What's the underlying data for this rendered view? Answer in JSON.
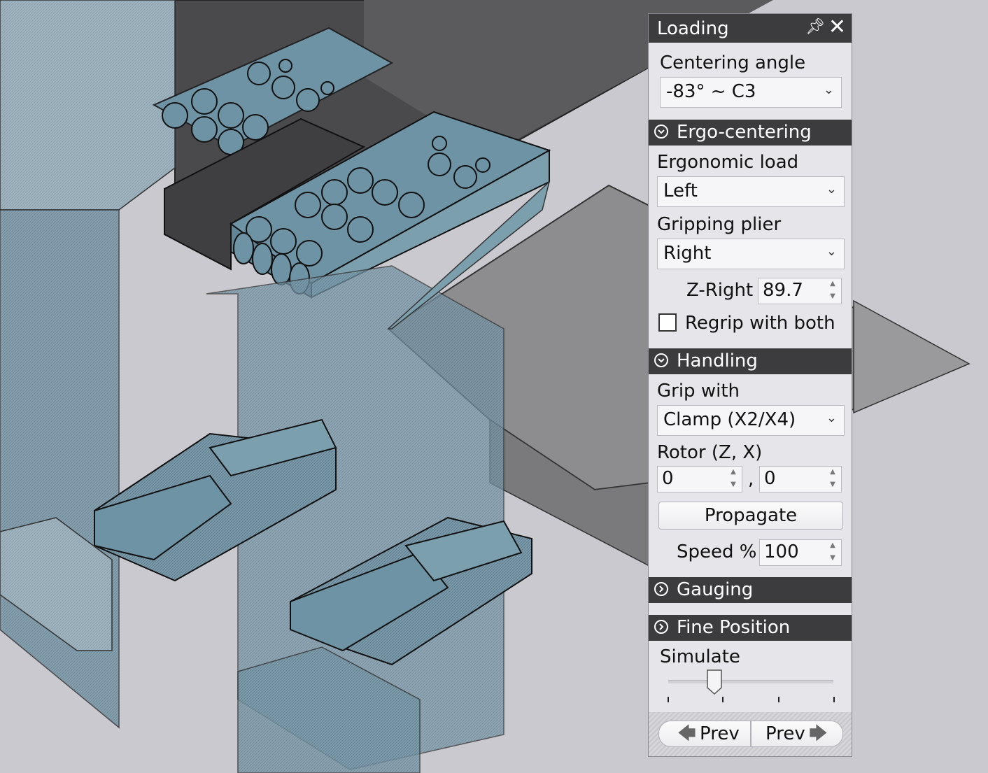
{
  "panel": {
    "title": "Loading",
    "centering_angle_label": "Centering angle",
    "centering_angle_value": "-83° ~ C3",
    "sections": {
      "ergo": "Ergo-centering",
      "handling": "Handling",
      "gauging": "Gauging",
      "fine_position": "Fine Position"
    },
    "ergo": {
      "ergonomic_load_label": "Ergonomic load",
      "ergonomic_load_value": "Left",
      "gripping_plier_label": "Gripping plier",
      "gripping_plier_value": "Right",
      "z_right_label": "Z-Right",
      "z_right_value": "89.7",
      "regrip_label": "Regrip with both",
      "regrip_checked": false
    },
    "handling": {
      "grip_with_label": "Grip with",
      "grip_with_value": "Clamp (X2/X4)",
      "rotor_label": "Rotor (Z, X)",
      "rotor_z": "0",
      "rotor_sep": ",",
      "rotor_x": "0",
      "propagate_label": "Propagate",
      "speed_label": "Speed %",
      "speed_value": "100"
    },
    "fine_position": {
      "simulate_label": "Simulate",
      "simulate_level": 0.28
    },
    "nav": {
      "prev_left_label": "Prev",
      "prev_right_label": "Prev"
    }
  },
  "colors": {
    "header": "#3c3c3e",
    "panel_bg": "#e6e6ea",
    "part_blue": "#6e93a4",
    "sheet_gray": "#8c8c8c"
  }
}
